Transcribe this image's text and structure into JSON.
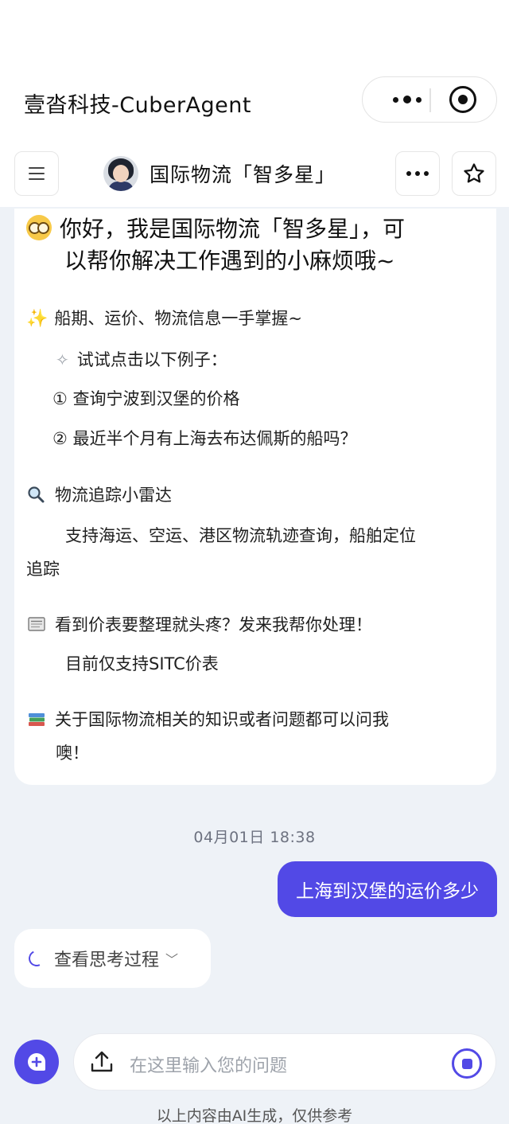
{
  "window": {
    "title": "壹沓科技-CuberAgent"
  },
  "header": {
    "agent_name": "国际物流「智多星」"
  },
  "welcome": {
    "greeting_line1": "你好，我是国际物流「智多星」，可",
    "greeting_line2": "以帮你解决工作遇到的小麻烦哦~",
    "section1_title": "船期、运价、物流信息一手掌握~",
    "examples_hint": "试试点击以下例子：",
    "example1": "① 查询宁波到汉堡的价格",
    "example2": "② 最近半个月有上海去布达佩斯的船吗？",
    "section2_title": "物流追踪小雷达",
    "section2_line1": "支持海运、空运、港区物流轨迹查询，船舶定位",
    "section2_line2": "追踪",
    "section3_title": "看到价表要整理就头疼？发来我帮你处理！",
    "section3_note": "目前仅支持SITC价表",
    "section4_line1": "关于国际物流相关的知识或者问题都可以问我",
    "section4_line2": "噢！"
  },
  "chat": {
    "timestamp": "04月01日  18:38",
    "user_message": "上海到汉堡的运价多少",
    "thinking_label": "查看思考过程"
  },
  "composer": {
    "placeholder": "在这里输入您的问题"
  },
  "footer": {
    "disclaimer": "以上内容由AI生成，仅供参考"
  },
  "icons": {
    "menu": "menu-icon",
    "more": "more-icon",
    "star": "star-icon",
    "record": "record-icon",
    "upload": "upload-icon",
    "stop": "stop-icon",
    "new_chat": "new-chat-icon"
  },
  "colors": {
    "accent": "#5249e6",
    "background": "#eef2f7"
  }
}
